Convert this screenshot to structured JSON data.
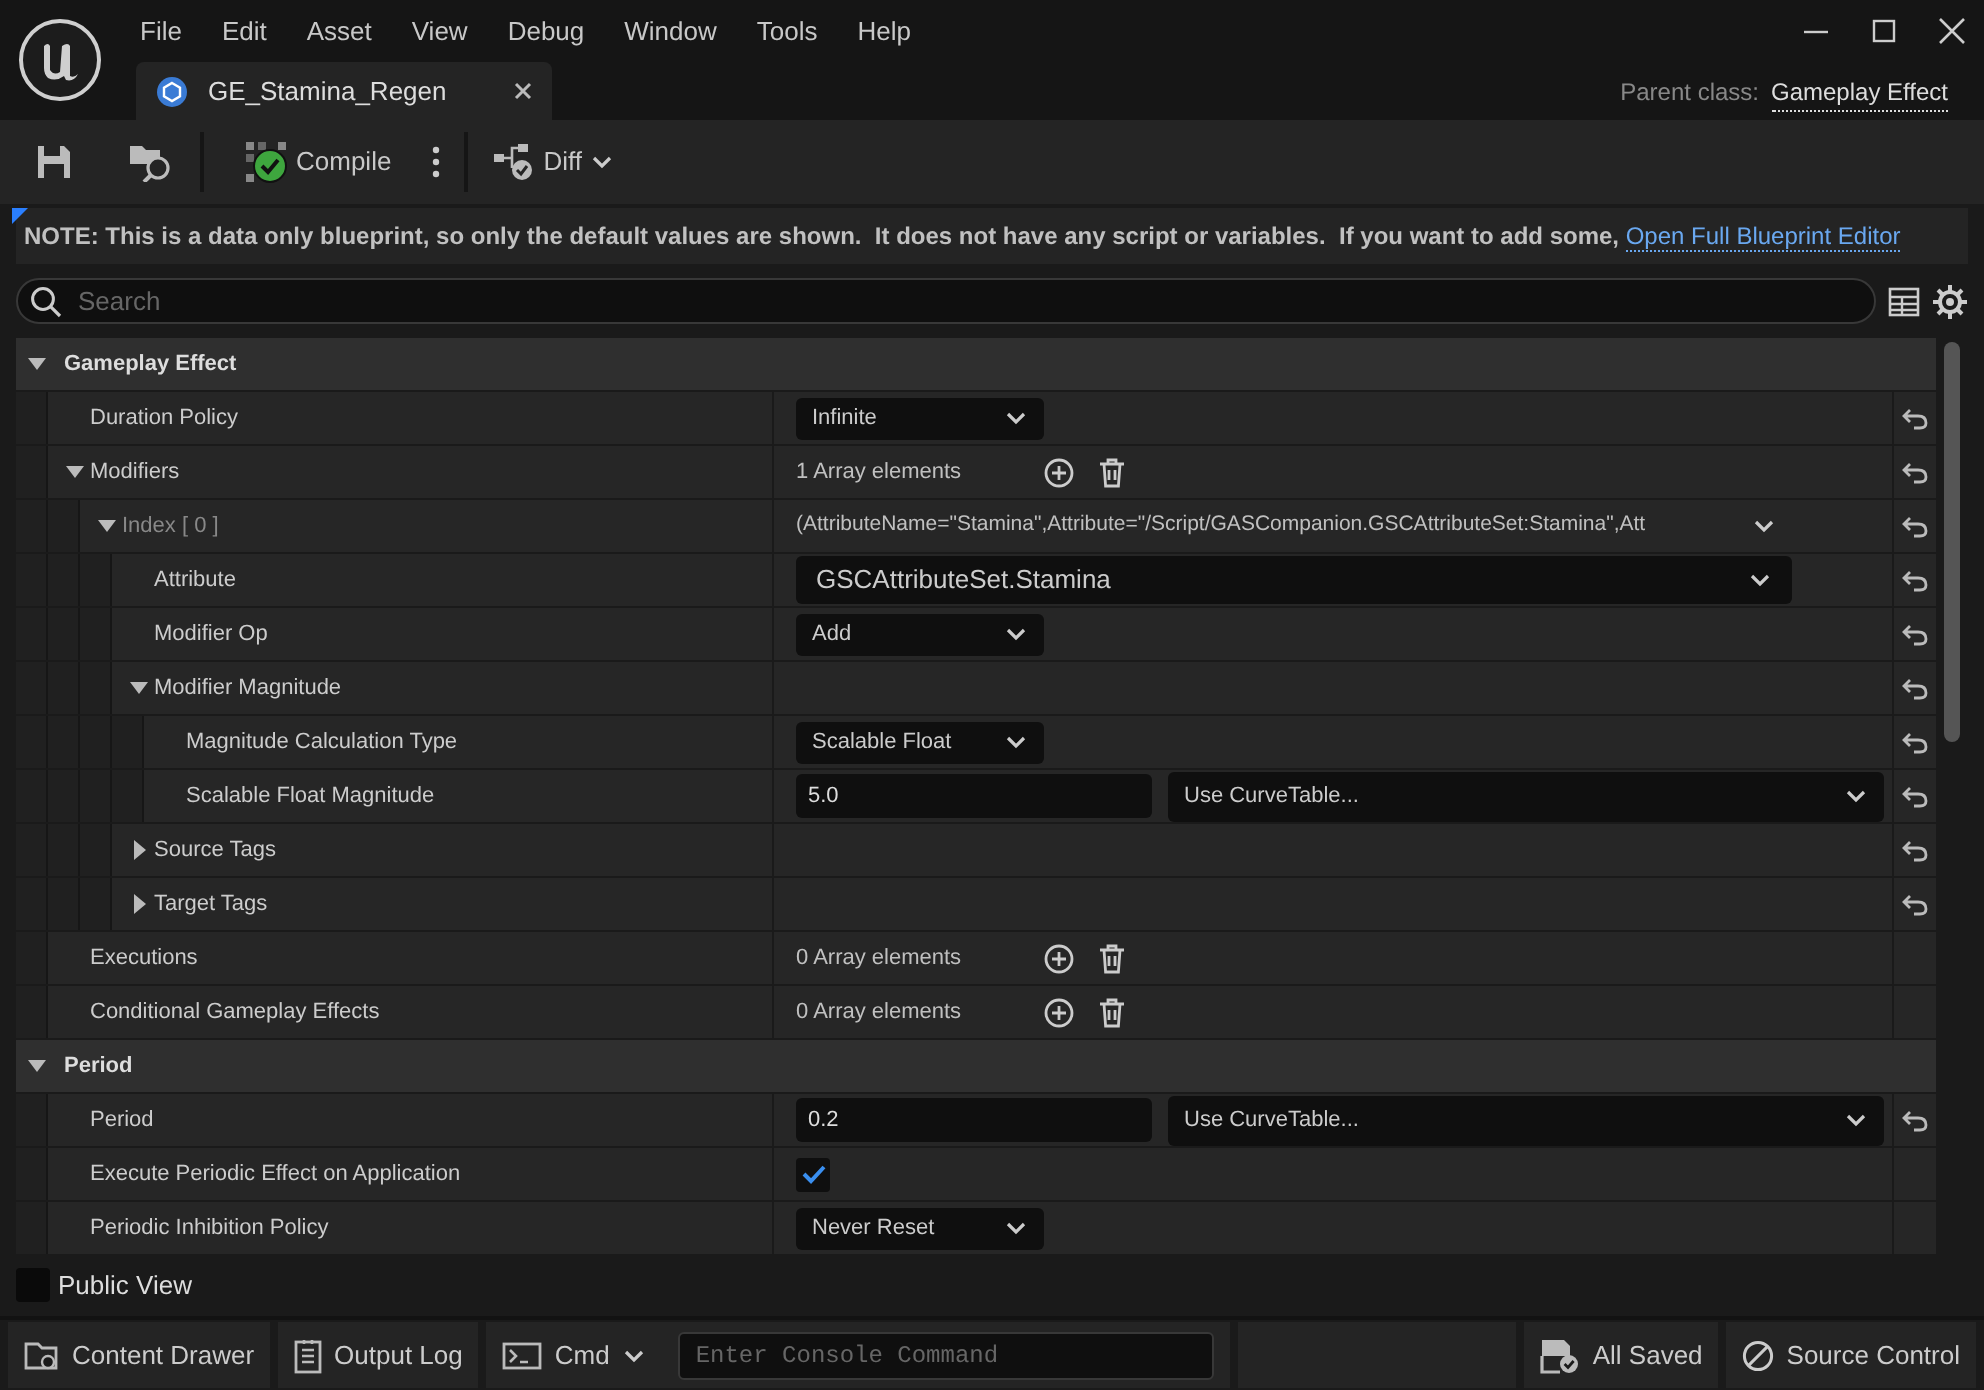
{
  "menu": [
    "File",
    "Edit",
    "Asset",
    "View",
    "Debug",
    "Window",
    "Tools",
    "Help"
  ],
  "tab": {
    "title": "GE_Stamina_Regen"
  },
  "parent_class": {
    "label": "Parent class:",
    "value": "Gameplay Effect"
  },
  "toolbar": {
    "compile": "Compile",
    "diff": "Diff"
  },
  "notice": {
    "text": "NOTE: This is a data only blueprint, so only the default values are shown.  It does not have any script or variables.  If you want to add some, ",
    "link": "Open Full Blueprint Editor"
  },
  "search": {
    "placeholder": "Search"
  },
  "rows": [
    {
      "kind": "category",
      "label": "Gameplay Effect",
      "expanded": true,
      "children": [
        {
          "kind": "property",
          "label": "Duration Policy",
          "resettable": true,
          "value": {
            "kind": "dropdown",
            "text": "Infinite"
          }
        },
        {
          "kind": "property",
          "label": "Modifiers",
          "expanded": true,
          "resettable": true,
          "value": {
            "kind": "array",
            "text": "1 Array elements"
          },
          "children": [
            {
              "kind": "property",
              "label": "Index [ 0 ]",
              "expanded": true,
              "resettable": true,
              "value": {
                "kind": "struct",
                "text": "(AttributeName=\"Stamina\",Attribute=\"/Script/GASCompanion.GSCAttributeSet:Stamina\",Att"
              },
              "children": [
                {
                  "kind": "property",
                  "label": "Attribute",
                  "resettable": true,
                  "value": {
                    "kind": "wide-dropdown",
                    "text": "GSCAttributeSet.Stamina"
                  }
                },
                {
                  "kind": "property",
                  "label": "Modifier Op",
                  "resettable": true,
                  "value": {
                    "kind": "dropdown",
                    "text": "Add"
                  }
                },
                {
                  "kind": "property",
                  "label": "Modifier Magnitude",
                  "expanded": true,
                  "resettable": true,
                  "children": [
                    {
                      "kind": "property",
                      "label": "Magnitude Calculation Type",
                      "resettable": true,
                      "value": {
                        "kind": "dropdown",
                        "text": "Scalable Float"
                      }
                    },
                    {
                      "kind": "property",
                      "label": "Scalable Float Magnitude",
                      "resettable": true,
                      "value": {
                        "kind": "float-curve",
                        "text": "5.0",
                        "curve": "Use CurveTable..."
                      }
                    }
                  ]
                },
                {
                  "kind": "property",
                  "label": "Source Tags",
                  "expanded": false,
                  "resettable": true
                },
                {
                  "kind": "property",
                  "label": "Target Tags",
                  "expanded": false,
                  "resettable": true
                }
              ]
            }
          ]
        },
        {
          "kind": "property",
          "label": "Executions",
          "resettable": false,
          "value": {
            "kind": "array",
            "text": "0 Array elements"
          }
        },
        {
          "kind": "property",
          "label": "Conditional Gameplay Effects",
          "resettable": false,
          "value": {
            "kind": "array",
            "text": "0 Array elements"
          }
        }
      ]
    },
    {
      "kind": "category",
      "label": "Period",
      "expanded": true,
      "children": [
        {
          "kind": "property",
          "label": "Period",
          "resettable": true,
          "value": {
            "kind": "float-curve",
            "text": "0.2",
            "curve": "Use CurveTable..."
          }
        },
        {
          "kind": "property",
          "label": "Execute Periodic Effect on Application",
          "resettable": false,
          "value": {
            "kind": "checkbox",
            "checked": true
          }
        },
        {
          "kind": "property",
          "label": "Periodic Inhibition Policy",
          "resettable": false,
          "value": {
            "kind": "dropdown",
            "text": "Never Reset"
          }
        }
      ]
    }
  ],
  "public_view": {
    "label": "Public View",
    "checked": false
  },
  "status_bar": {
    "content_drawer": "Content Drawer",
    "output_log": "Output Log",
    "cmd": "Cmd",
    "console_placeholder": "Enter Console Command",
    "saved": "All Saved",
    "source_control": "Source Control"
  }
}
